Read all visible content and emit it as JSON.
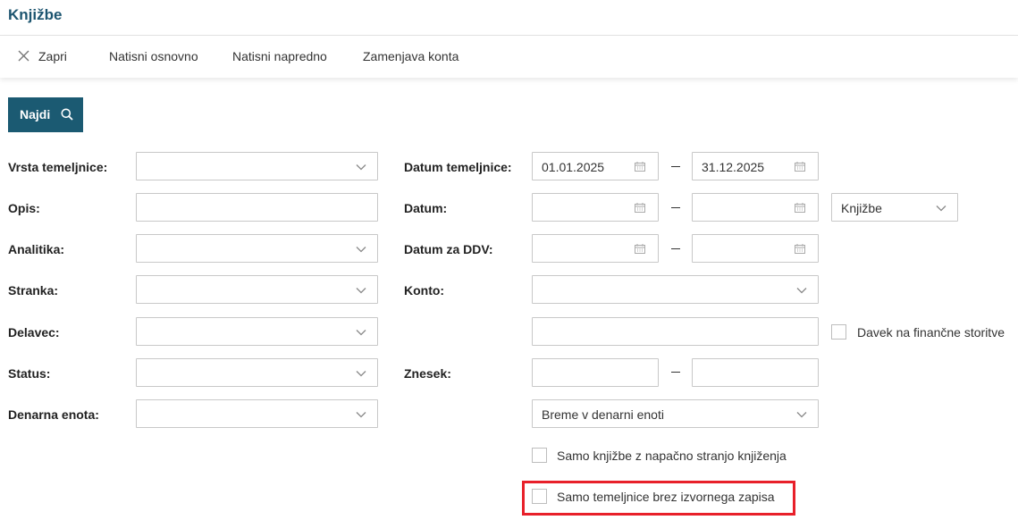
{
  "header": {
    "title": "Knjižbe"
  },
  "toolbar": {
    "close_label": "Zapri",
    "print_basic": "Natisni osnovno",
    "print_advanced": "Natisni napredno",
    "account_replace": "Zamenjava konta"
  },
  "actions": {
    "find_label": "Najdi"
  },
  "left_form": {
    "doc_type_label": "Vrsta temeljnice:",
    "doc_type_value": "",
    "description_label": "Opis:",
    "description_value": "",
    "analytics_label": "Analitika:",
    "analytics_value": "",
    "customer_label": "Stranka:",
    "customer_value": "",
    "employee_label": "Delavec:",
    "employee_value": "",
    "status_label": "Status:",
    "status_value": "",
    "currency_label": "Denarna enota:",
    "currency_value": ""
  },
  "right_form": {
    "doc_date_label": "Datum temeljnice:",
    "doc_date_from": "01.01.2025",
    "doc_date_to": "31.12.2025",
    "date_label": "Datum:",
    "date_from": "",
    "date_to": "",
    "date_type_value": "Knjižbe",
    "vat_date_label": "Datum za DDV:",
    "vat_date_from": "",
    "vat_date_to": "",
    "account_label": "Konto:",
    "account_value": "",
    "account_text": "",
    "fin_services_tax_label": "Davek na finančne storitve",
    "amount_label": "Znesek:",
    "amount_from": "",
    "amount_to": "",
    "amount_type_value": "Breme v denarni enoti",
    "wrong_side_label": "Samo knjižbe z napačno stranjo knjiženja",
    "no_source_label": "Samo temeljnice brez izvornega zapisa"
  },
  "colors": {
    "brand": "#1b5a72",
    "title": "#1d5570",
    "highlight": "#e8202a"
  }
}
